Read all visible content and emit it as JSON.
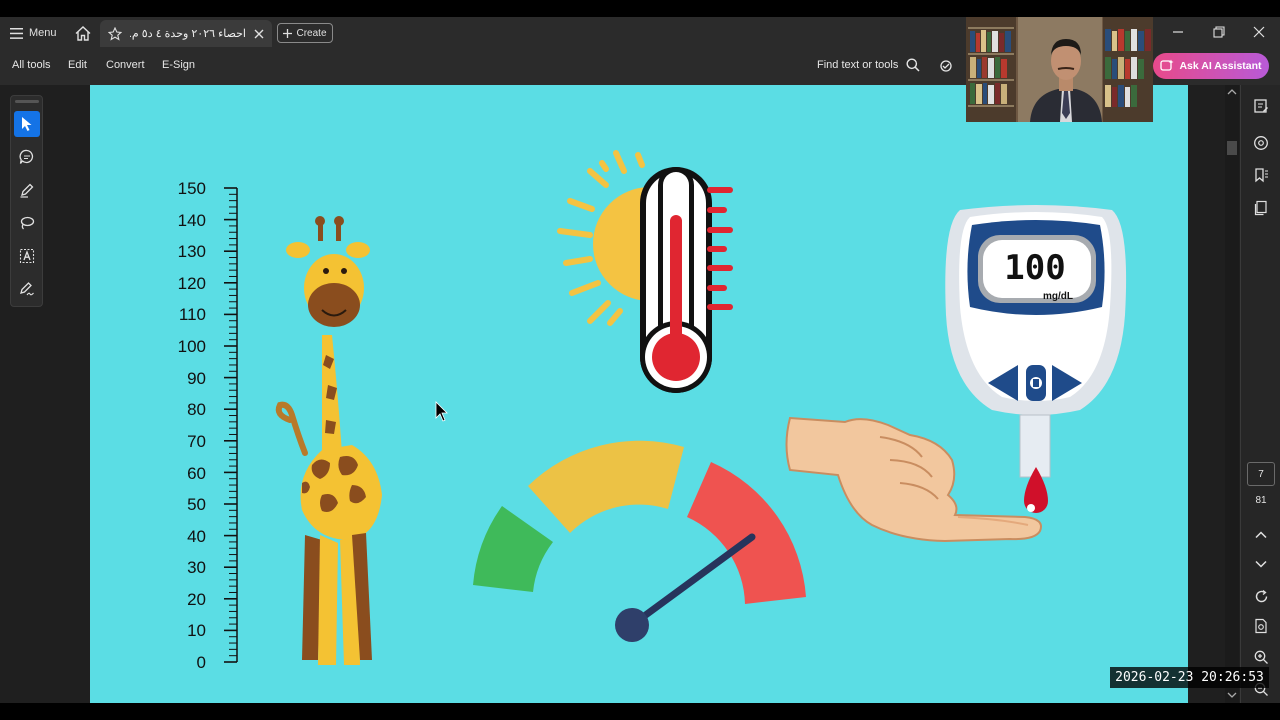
{
  "titlebar": {
    "menu_label": "Menu",
    "tab_title": "احصاء ٢٠٢٦ وحدة ٤ د٥ م.م...",
    "create_label": "Create"
  },
  "toolbar": {
    "all_tools": "All tools",
    "edit": "Edit",
    "convert": "Convert",
    "esign": "E-Sign",
    "find_label": "Find text or tools",
    "ai_assistant": "Ask AI Assistant"
  },
  "document": {
    "ruler_labels": [
      "150",
      "140",
      "130",
      "120",
      "110",
      "100",
      "90",
      "80",
      "70",
      "60",
      "50",
      "40",
      "30",
      "20",
      "10",
      "0"
    ],
    "glucometer_reading": "100",
    "glucometer_unit": "mg/dL"
  },
  "pagination": {
    "current_page": "7",
    "total_pages": "81"
  },
  "overlay": {
    "timestamp": "2026-02-23  20:26:53"
  },
  "colors": {
    "slide_background": "#5bdde4",
    "ai_button_gradient_start": "#e84a8a",
    "ai_button_gradient_end": "#b85ad8",
    "active_tool": "#1473e6",
    "gauge_green": "#3fba5a",
    "gauge_yellow": "#ecc245",
    "gauge_red": "#ef5350"
  },
  "icons": {
    "menu": "hamburger-icon",
    "home": "home-icon",
    "star": "star-icon",
    "close": "close-icon",
    "plus": "plus-icon",
    "search": "search-icon",
    "ai": "ai-sparkle-icon"
  }
}
